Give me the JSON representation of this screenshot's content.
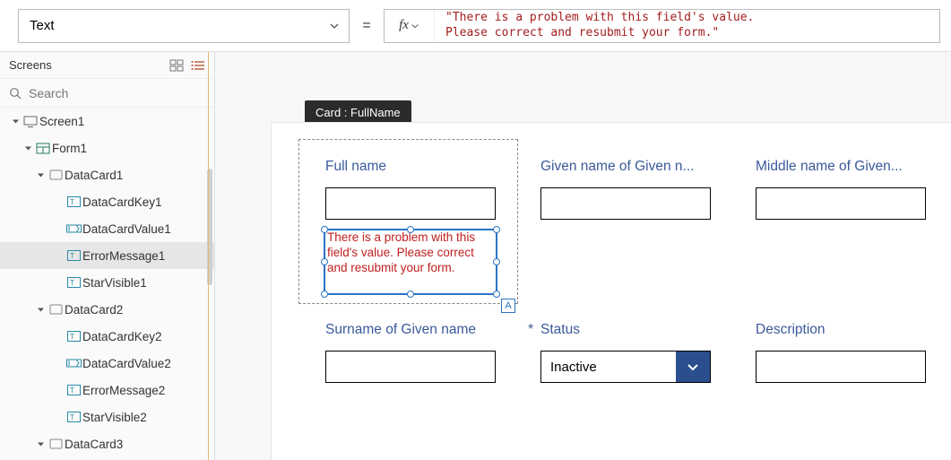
{
  "property_dropdown": {
    "selected": "Text"
  },
  "equals": "=",
  "fx_label": "fx",
  "formula_text": "\"There is a problem with this field's value.\nPlease correct and resubmit your form.\"",
  "left_panel": {
    "title": "Screens",
    "search_placeholder": "Search"
  },
  "tree": [
    {
      "label": "Screen1",
      "indent": 10,
      "caret": true,
      "icon": "screen",
      "sel": false
    },
    {
      "label": "Form1",
      "indent": 24,
      "caret": true,
      "icon": "form",
      "sel": false
    },
    {
      "label": "DataCard1",
      "indent": 38,
      "caret": true,
      "icon": "card",
      "sel": false
    },
    {
      "label": "DataCardKey1",
      "indent": 58,
      "caret": false,
      "icon": "textctl",
      "sel": false
    },
    {
      "label": "DataCardValue1",
      "indent": 58,
      "caret": false,
      "icon": "inputctl",
      "sel": false
    },
    {
      "label": "ErrorMessage1",
      "indent": 58,
      "caret": false,
      "icon": "textctl",
      "sel": true
    },
    {
      "label": "StarVisible1",
      "indent": 58,
      "caret": false,
      "icon": "textctl",
      "sel": false
    },
    {
      "label": "DataCard2",
      "indent": 38,
      "caret": true,
      "icon": "card",
      "sel": false
    },
    {
      "label": "DataCardKey2",
      "indent": 58,
      "caret": false,
      "icon": "textctl",
      "sel": false
    },
    {
      "label": "DataCardValue2",
      "indent": 58,
      "caret": false,
      "icon": "inputctl",
      "sel": false
    },
    {
      "label": "ErrorMessage2",
      "indent": 58,
      "caret": false,
      "icon": "textctl",
      "sel": false
    },
    {
      "label": "StarVisible2",
      "indent": 58,
      "caret": false,
      "icon": "textctl",
      "sel": false
    },
    {
      "label": "DataCard3",
      "indent": 38,
      "caret": true,
      "icon": "card",
      "sel": false
    }
  ],
  "canvas": {
    "tooltip": "Card : FullName",
    "error_text": "There is a problem with this field's value.  Please correct and resubmit your form.",
    "select_badge": "A",
    "fields": {
      "fullname": {
        "label": "Full name"
      },
      "given": {
        "label": "Given name of Given n..."
      },
      "middle": {
        "label": "Middle name of Given..."
      },
      "surname": {
        "label": "Surname of Given name"
      },
      "status": {
        "label": "Status",
        "required": "*",
        "value": "Inactive"
      },
      "description": {
        "label": "Description"
      }
    }
  }
}
